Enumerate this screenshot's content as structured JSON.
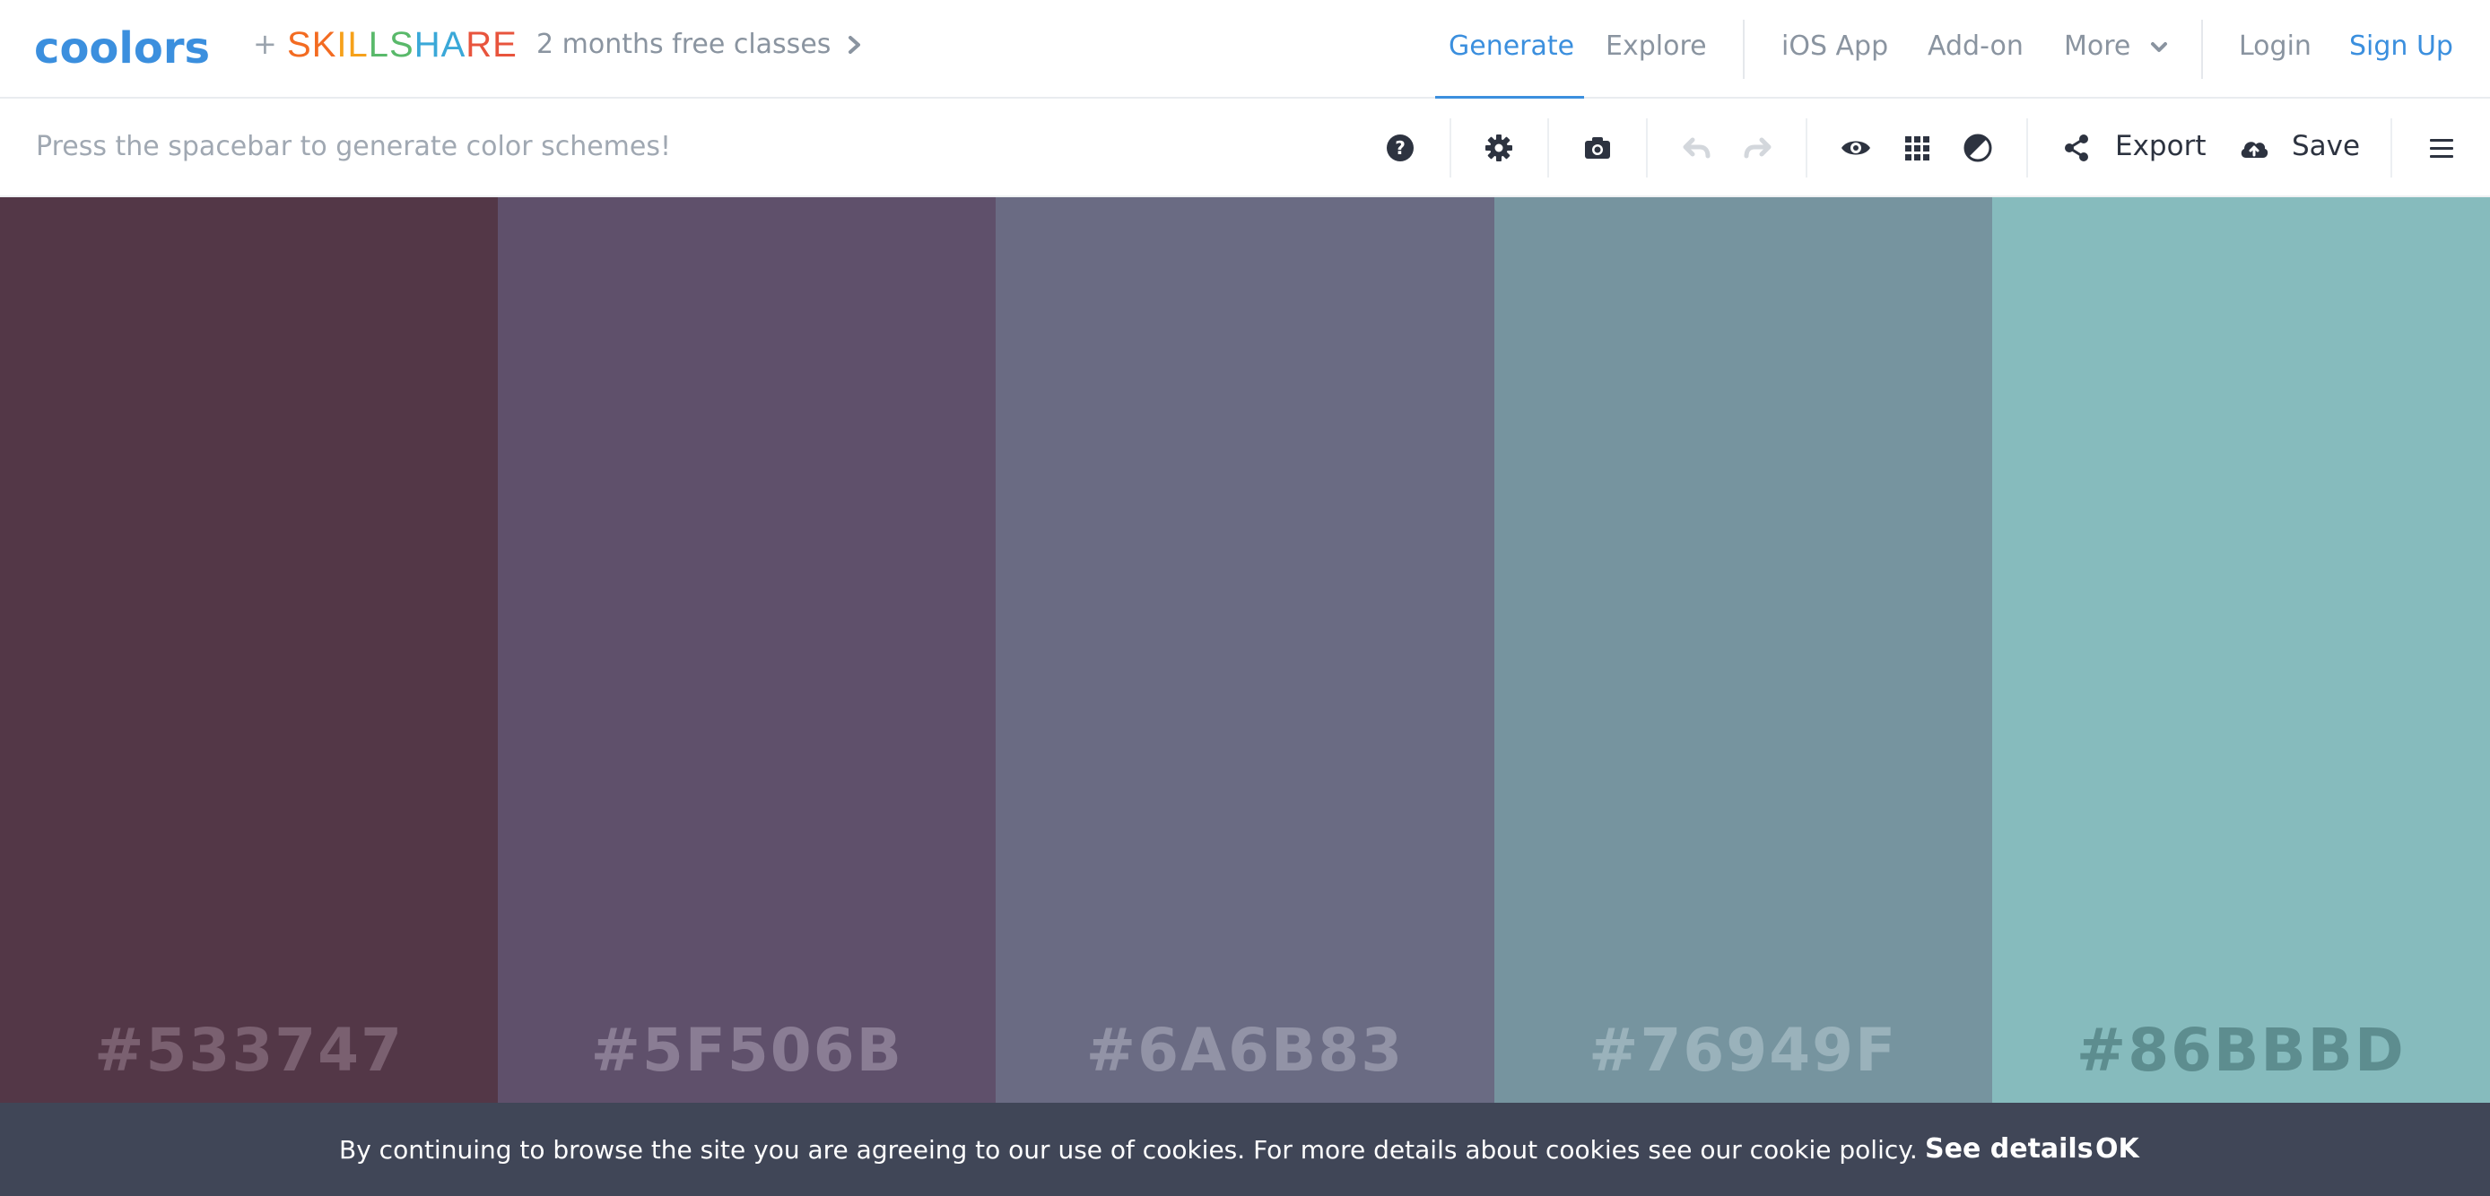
{
  "header": {
    "logo_text": "coolors",
    "plus": "+",
    "partner": "SKILLSHARE",
    "partner_letter_colors": [
      "#f36b21",
      "#f36b21",
      "#f6a11a",
      "#f6a11a",
      "#59b96a",
      "#59b96a",
      "#3aa8d8",
      "#3aa8d8",
      "#e8543d",
      "#e8543d"
    ],
    "promo": "2 months free classes",
    "nav": {
      "generate": "Generate",
      "explore": "Explore",
      "ios_app": "iOS App",
      "addon": "Add-on",
      "more": "More",
      "login": "Login",
      "signup": "Sign Up"
    }
  },
  "toolbar": {
    "hint": "Press the spacebar to generate color schemes!",
    "export": "Export",
    "save": "Save",
    "icons": [
      "help-icon",
      "settings-icon",
      "camera-icon",
      "undo-icon",
      "redo-icon",
      "view-icon",
      "grid-icon",
      "contrast-icon",
      "share-icon",
      "cloud-upload-icon",
      "menu-icon"
    ]
  },
  "palette": [
    {
      "hex": "#533747",
      "color": "#533747",
      "text_color": "#7a6070"
    },
    {
      "hex": "#5F506B",
      "color": "#5F506B",
      "text_color": "#8a7d94"
    },
    {
      "hex": "#6A6B83",
      "color": "#6A6B83",
      "text_color": "#9293a6"
    },
    {
      "hex": "#76949F",
      "color": "#76949F",
      "text_color": "#9ab2bb"
    },
    {
      "hex": "#86BBBD",
      "color": "#86BBBD",
      "text_color": "#5d8d8f"
    }
  ],
  "cookie": {
    "text": "By continuing to browse the site you are agreeing to our use of cookies. For more details about cookies see our cookie policy.",
    "details": "See details",
    "ok": "OK"
  },
  "colors": {
    "accent": "#3b8fde",
    "banner_bg": "#404657",
    "nav_text": "#8a94a0"
  }
}
